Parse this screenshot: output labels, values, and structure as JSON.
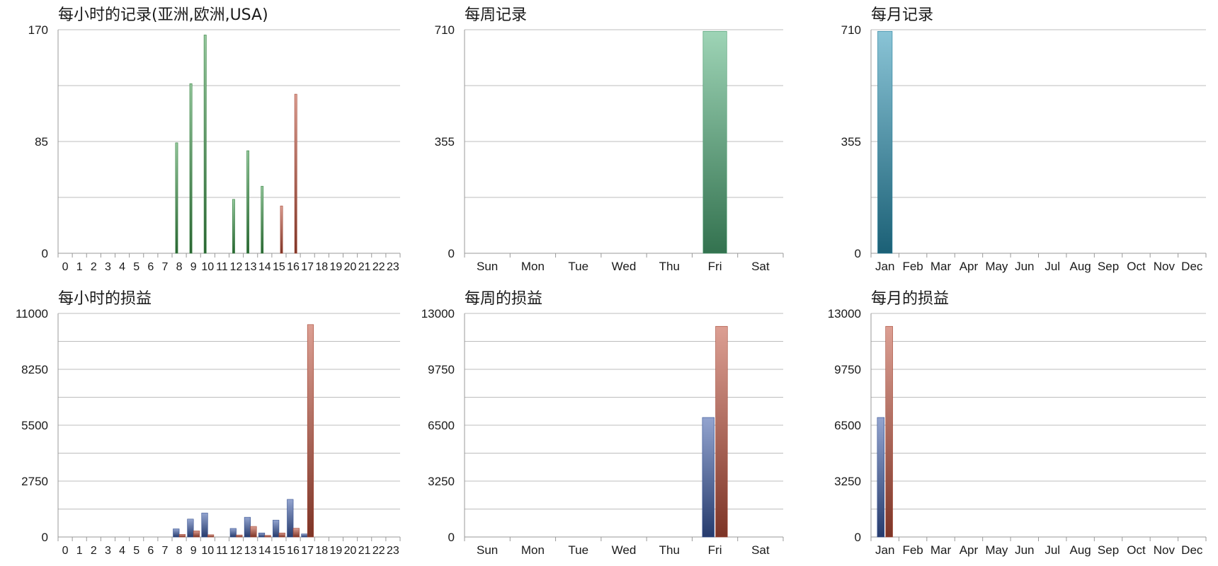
{
  "chart_data": [
    {
      "type": "bar",
      "title": "每小时的记录(亚洲,欧洲,USA)",
      "categories": [
        "0",
        "1",
        "2",
        "3",
        "4",
        "5",
        "6",
        "7",
        "8",
        "9",
        "10",
        "11",
        "12",
        "13",
        "14",
        "15",
        "16",
        "17",
        "18",
        "19",
        "20",
        "21",
        "22",
        "23"
      ],
      "series": [
        {
          "values": [
            0,
            0,
            0,
            0,
            0,
            0,
            0,
            0,
            84,
            129,
            166,
            0,
            41,
            78,
            51,
            0,
            0,
            0,
            0,
            0,
            0,
            0,
            0,
            0
          ],
          "color": "#3f9a4c"
        },
        {
          "values": [
            0,
            0,
            0,
            0,
            0,
            0,
            0,
            0,
            0,
            0,
            0,
            0,
            0,
            0,
            0,
            36,
            121,
            0,
            0,
            0,
            0,
            0,
            0,
            0
          ],
          "color": "#c0503a"
        }
      ],
      "ylim": [
        0,
        170
      ],
      "yticks": [
        "0",
        "85",
        "170"
      ],
      "grid": true
    },
    {
      "type": "bar",
      "title": "每周记录",
      "categories": [
        "Sun",
        "Mon",
        "Tue",
        "Wed",
        "Thu",
        "Fri",
        "Sat"
      ],
      "series": [
        {
          "values": [
            0,
            0,
            0,
            0,
            0,
            705,
            0
          ],
          "color": "#4fb07a"
        }
      ],
      "ylim": [
        0,
        710
      ],
      "yticks": [
        "0",
        "355",
        "710"
      ],
      "grid": true
    },
    {
      "type": "bar",
      "title": "每月记录",
      "categories": [
        "Jan",
        "Feb",
        "Mar",
        "Apr",
        "May",
        "Jun",
        "Jul",
        "Aug",
        "Sep",
        "Oct",
        "Nov",
        "Dec"
      ],
      "series": [
        {
          "values": [
            705,
            0,
            0,
            0,
            0,
            0,
            0,
            0,
            0,
            0,
            0,
            0
          ],
          "color": "#2a93b5"
        }
      ],
      "ylim": [
        0,
        710
      ],
      "yticks": [
        "0",
        "355",
        "710"
      ],
      "grid": true
    },
    {
      "type": "bar",
      "title": "每小时的损益",
      "categories": [
        "0",
        "1",
        "2",
        "3",
        "4",
        "5",
        "6",
        "7",
        "8",
        "9",
        "10",
        "11",
        "12",
        "13",
        "14",
        "15",
        "16",
        "17",
        "18",
        "19",
        "20",
        "21",
        "22",
        "23"
      ],
      "series": [
        {
          "values": [
            0,
            0,
            0,
            0,
            0,
            0,
            0,
            0,
            400,
            880,
            1180,
            0,
            420,
            970,
            200,
            830,
            1850,
            150,
            0,
            0,
            0,
            0,
            0,
            0
          ],
          "color": "#3a5aa8"
        },
        {
          "values": [
            0,
            0,
            0,
            0,
            0,
            0,
            0,
            0,
            130,
            300,
            110,
            0,
            100,
            520,
            80,
            200,
            430,
            10450,
            0,
            0,
            0,
            0,
            0,
            0
          ],
          "color": "#c0503a"
        }
      ],
      "ylim": [
        0,
        11000
      ],
      "yticks": [
        "0",
        "2750",
        "5500",
        "8250",
        "11000"
      ],
      "grid": true
    },
    {
      "type": "bar",
      "title": "每周的损益",
      "categories": [
        "Sun",
        "Mon",
        "Tue",
        "Wed",
        "Thu",
        "Fri",
        "Sat"
      ],
      "series": [
        {
          "values": [
            0,
            0,
            0,
            0,
            0,
            6950,
            0
          ],
          "color": "#3a5aa8"
        },
        {
          "values": [
            0,
            0,
            0,
            0,
            0,
            12250,
            0
          ],
          "color": "#c0503a"
        }
      ],
      "ylim": [
        0,
        13000
      ],
      "yticks": [
        "0",
        "3250",
        "6500",
        "9750",
        "13000"
      ],
      "grid": true
    },
    {
      "type": "bar",
      "title": "每月的损益",
      "categories": [
        "Jan",
        "Feb",
        "Mar",
        "Apr",
        "May",
        "Jun",
        "Jul",
        "Aug",
        "Sep",
        "Oct",
        "Nov",
        "Dec"
      ],
      "series": [
        {
          "values": [
            6950,
            0,
            0,
            0,
            0,
            0,
            0,
            0,
            0,
            0,
            0,
            0
          ],
          "color": "#3a5aa8"
        },
        {
          "values": [
            12250,
            0,
            0,
            0,
            0,
            0,
            0,
            0,
            0,
            0,
            0,
            0
          ],
          "color": "#c0503a"
        }
      ],
      "ylim": [
        0,
        13000
      ],
      "yticks": [
        "0",
        "3250",
        "6500",
        "9750",
        "13000"
      ],
      "grid": true
    }
  ]
}
